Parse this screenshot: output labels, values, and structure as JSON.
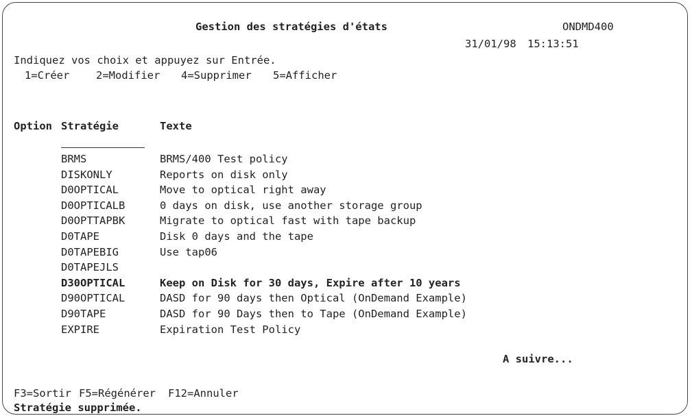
{
  "header": {
    "title": "Gestion des stratégies d'états",
    "screen_id": "ONDMD400",
    "date": "31/01/98",
    "time": "15:13:51"
  },
  "instructions": {
    "line": "Indiquez vos choix et appuyez sur Entrée.",
    "options": [
      "1=Créer",
      "2=Modifier",
      "4=Supprimer",
      "5=Afficher"
    ]
  },
  "table": {
    "columns": [
      "Option",
      "Stratégie",
      "Texte"
    ],
    "rows": [
      {
        "strategy": "BRMS",
        "text": "BRMS/400 Test policy",
        "bold": false
      },
      {
        "strategy": "DISKONLY",
        "text": "Reports on disk only",
        "bold": false
      },
      {
        "strategy": "D0OPTICAL",
        "text": "Move to optical right away",
        "bold": false
      },
      {
        "strategy": "D0OPTICALB",
        "text": "0 days on disk, use another storage group",
        "bold": false
      },
      {
        "strategy": "D0OPTTAPBK",
        "text": "Migrate to optical fast with tape backup",
        "bold": false
      },
      {
        "strategy": "D0TAPE",
        "text": "Disk 0 days and the tape",
        "bold": false
      },
      {
        "strategy": "D0TAPEBIG",
        "text": "Use tap06",
        "bold": false
      },
      {
        "strategy": "D0TAPEJLS",
        "text": "",
        "bold": false
      },
      {
        "strategy": "D30OPTICAL",
        "text": "Keep on Disk for 30 days, Expire after 10 years",
        "bold": true
      },
      {
        "strategy": "D90OPTICAL",
        "text": "DASD for 90 days then Optical (OnDemand Example)",
        "bold": false
      },
      {
        "strategy": "D90TAPE",
        "text": "DASD for 90 Days then to Tape (OnDemand Example)",
        "bold": false
      },
      {
        "strategy": "EXPIRE",
        "text": "Expiration Test Policy",
        "bold": false
      }
    ],
    "more": "A suivre..."
  },
  "footer": {
    "keys": [
      "F3=Sortir",
      "F5=Régénérer",
      "F12=Annuler"
    ],
    "message": "Stratégie supprimée."
  }
}
